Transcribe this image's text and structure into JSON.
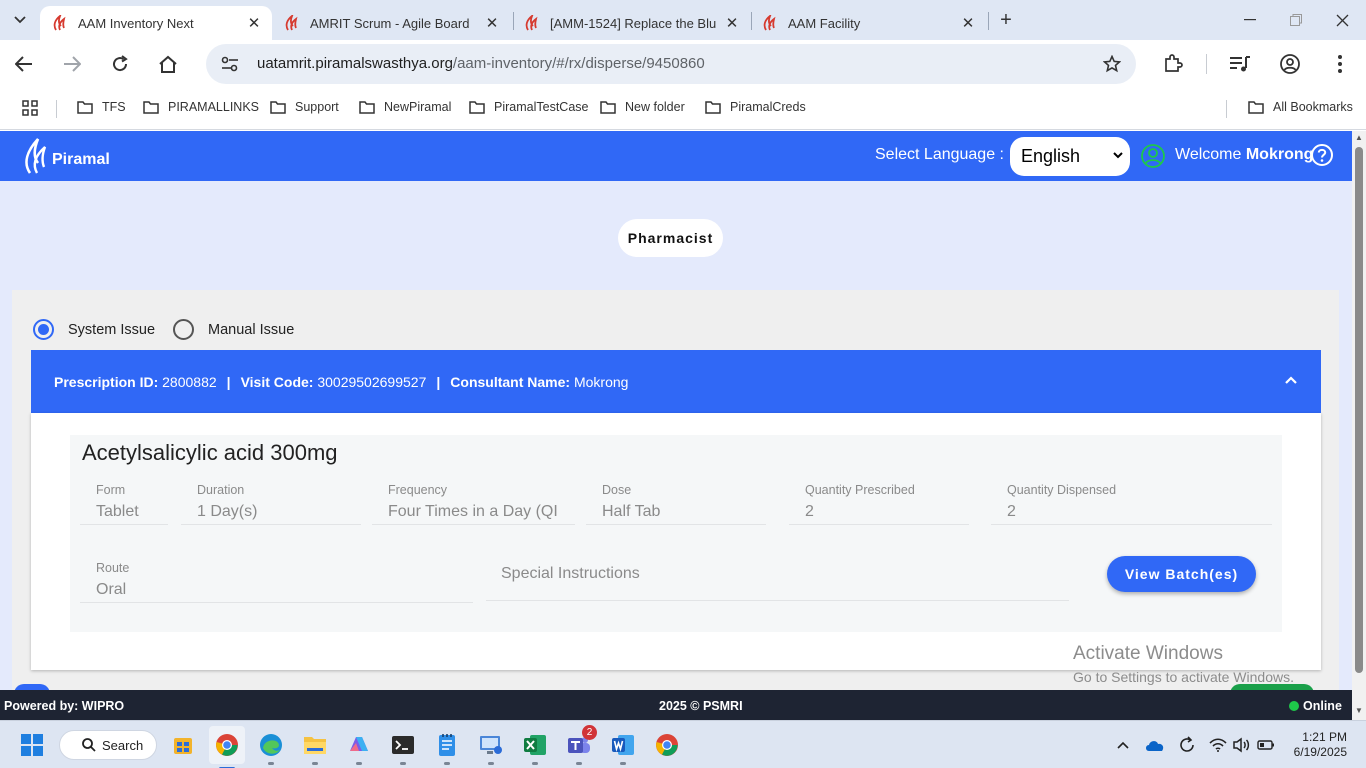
{
  "browser": {
    "tabs": [
      {
        "title": "AAM Inventory Next",
        "active": true
      },
      {
        "title": "AMRIT Scrum - Agile Board",
        "active": false
      },
      {
        "title": "[AMM-1524] Replace the Blu",
        "active": false
      },
      {
        "title": "AAM Facility",
        "active": false
      }
    ],
    "url_host": "uatamrit.piramalswasthya.org",
    "url_path": "/aam-inventory/#/rx/disperse/9450860",
    "bookmarks": [
      "TFS",
      "PIRAMALLINKS",
      "Support",
      "NewPiramal",
      "PiramalTestCase",
      "New folder",
      "PiramalCreds"
    ],
    "all_bookmarks": "All Bookmarks"
  },
  "header": {
    "logo_text": "Piramal",
    "language_label": "Select Language :",
    "language_value": "English",
    "welcome": "Welcome",
    "user_name": "Mokrong"
  },
  "main": {
    "role": "Pharmacist",
    "issue_types": [
      {
        "label": "System Issue",
        "checked": true
      },
      {
        "label": "Manual Issue",
        "checked": false
      }
    ],
    "prescription": {
      "id_label": "Prescription ID:",
      "id_value": "2800882",
      "visit_label": "Visit Code:",
      "visit_value": "30029502699527",
      "consultant_label": "Consultant Name:",
      "consultant_value": "Mokrong"
    },
    "item": {
      "name": "Acetylsalicylic acid 300mg",
      "fields": [
        {
          "label": "Form",
          "value": "Tablet"
        },
        {
          "label": "Duration",
          "value": "1 Day(s)"
        },
        {
          "label": "Frequency",
          "value": "Four Times in a Day (QI"
        },
        {
          "label": "Dose",
          "value": "Half Tab"
        },
        {
          "label": "Quantity Prescribed",
          "value": "2"
        },
        {
          "label": "Quantity Dispensed",
          "value": "2"
        },
        {
          "label": "Route",
          "value": "Oral"
        }
      ],
      "special_placeholder": "Special Instructions",
      "view_batch_label": "View Batch(es)"
    }
  },
  "watermark": {
    "line1": "Activate Windows",
    "line2": "Go to Settings to activate Windows."
  },
  "footer": {
    "powered": "Powered by: WIPRO",
    "copyright": "2025 © PSMRI",
    "status": "Online"
  },
  "taskbar": {
    "search": "Search",
    "teams_badge": "2",
    "time": "1:21 PM",
    "date": "6/19/2025"
  },
  "colors": {
    "primary": "#3068f6",
    "footer": "#1e2433",
    "online": "#1ec84a"
  }
}
